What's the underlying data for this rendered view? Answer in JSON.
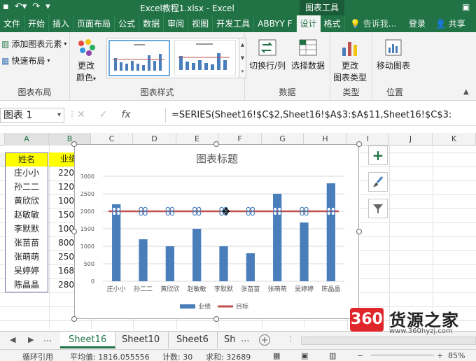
{
  "titlebar": {
    "window_title": "Excel教程1.xlsx - Excel",
    "context_title": "图表工具",
    "ribbon_options": "▣"
  },
  "tabs": [
    {
      "label": "文件"
    },
    {
      "label": "开始"
    },
    {
      "label": "插入"
    },
    {
      "label": "页面布局"
    },
    {
      "label": "公式"
    },
    {
      "label": "数据"
    },
    {
      "label": "审阅"
    },
    {
      "label": "视图"
    },
    {
      "label": "开发工具"
    },
    {
      "label": "ABBYY F"
    },
    {
      "label": "设计"
    },
    {
      "label": "格式"
    }
  ],
  "tellme": "告诉我...",
  "login": "登录",
  "share": "共享",
  "ribbon": {
    "add_element": "添加图表元素",
    "quick_layout": "快速布局",
    "change_color_1": "更改",
    "change_color_2": "颜色",
    "group_layouts": "图表布局",
    "group_styles": "图表样式",
    "switch_rowcol": "切换行/列",
    "select_data": "选择数据",
    "group_data": "数据",
    "change_type_1": "更改",
    "change_type_2": "图表类型",
    "group_type": "类型",
    "move_chart": "移动图表",
    "group_location": "位置"
  },
  "formulabar": {
    "namebox": "图表 1",
    "cancel": "✕",
    "enter": "✓",
    "fx": "fx",
    "formula": "=SERIES(Sheet16!$C$2,Sheet16!$A$3:$A$11,Sheet16!$C$3:"
  },
  "columns": [
    "A",
    "B",
    "C",
    "D",
    "E",
    "F",
    "G",
    "H",
    "I",
    "J",
    "K"
  ],
  "table": {
    "header_a": "姓名",
    "header_b": "业绩",
    "rows": [
      {
        "name": "庄小小",
        "value": "220"
      },
      {
        "name": "孙二二",
        "value": "120"
      },
      {
        "name": "黄欣欣",
        "value": "100"
      },
      {
        "name": "赵敏敏",
        "value": "150"
      },
      {
        "name": "李默默",
        "value": "100"
      },
      {
        "name": "张苗苗",
        "value": "800"
      },
      {
        "name": "张萌萌",
        "value": "250"
      },
      {
        "name": "吴婷婷",
        "value": "168"
      },
      {
        "name": "陈晶晶",
        "value": "280"
      }
    ]
  },
  "chart_data": {
    "type": "bar",
    "title": "图表标题",
    "categories": [
      "庄小小",
      "孙二二",
      "黄欣欣",
      "赵敏敏",
      "李默默",
      "张苗苗",
      "张萌萌",
      "吴婷婷",
      "陈晶晶"
    ],
    "series": [
      {
        "name": "业绩",
        "type": "bar",
        "color": "#4a7ebb",
        "values": [
          2200,
          1200,
          1000,
          1500,
          1000,
          800,
          2500,
          1680,
          2800
        ]
      },
      {
        "name": "目标",
        "type": "line",
        "color": "#c0504d",
        "values": [
          2000,
          2000,
          2000,
          2000,
          2000,
          2000,
          2000,
          2000,
          2000
        ]
      }
    ],
    "ylim": [
      0,
      3000
    ],
    "yticks": [
      0,
      500,
      1000,
      1500,
      2000,
      2500,
      3000
    ],
    "grid": true,
    "legend": "bottom"
  },
  "sheets": {
    "more_left": "...",
    "tabs": [
      {
        "label": "Sheet16",
        "active": true
      },
      {
        "label": "Sheet10",
        "active": false
      },
      {
        "label": "Sheet6",
        "active": false
      },
      {
        "label": "Sh",
        "active": false
      }
    ],
    "more_right": "...",
    "add": "+"
  },
  "status": {
    "circular": "循环引用",
    "average": "平均值: 1816.055556",
    "count": "计数: 30",
    "sum": "求和: 32689",
    "zoom": "85%"
  },
  "watermark": {
    "badge": "360",
    "brand": "货源之家",
    "url": "www.360hyzj.com"
  }
}
